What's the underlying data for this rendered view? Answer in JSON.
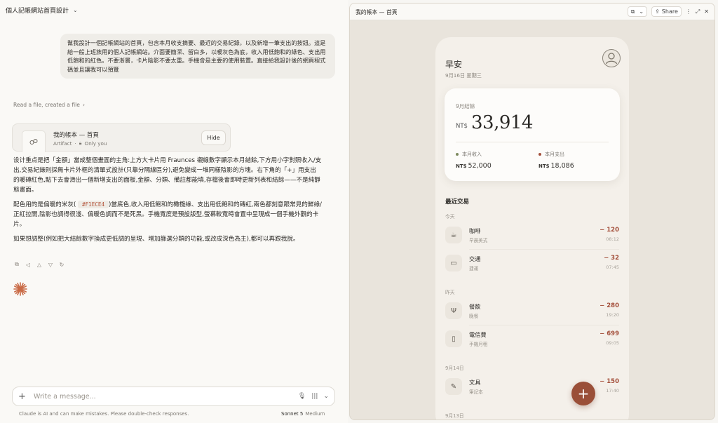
{
  "conversation": {
    "title": "個人記帳網站首頁設計",
    "user_message": "幫我設計一個記帳網站的首頁，包含本月收支摘要、最近的交易紀錄，以及新增一筆支出的按鈕。這是給一般上班族用的個人記帳網站。介面要簡潔、留白多，以暖灰色為底，收入用低飽和的綠色、支出用低飽和的紅色。不要漸層，卡片陰影不要太重。手機會是主要的使用裝置。直接給我設計後的網頁程式碼並且讓我可以預覽",
    "read_file": "Read a file, created a file",
    "artifact": {
      "title": "我的帳本 — 首頁",
      "type": "Artifact",
      "visibility": "Only you",
      "hide_label": "Hide"
    },
    "reply": {
      "p1": "设计重点是把「金額」當成整個畫面的主角:上方大卡片用 Fraunces 襯線數字顯示本月結餘,下方用小字對照收入/支出,交易紀錄則採無卡片外框的清單式設計(只靠分隔線區分),避免變成一堆同樣陰影的方塊。右下角的「+」用支出的暖磚紅色,點下去會滑出一個新增支出的面板,金額、分類、備註都能填,存檔後會即時更新列表和結餘——不是純靜態畫面。",
      "p2a": "配色用的是偏暖的米灰(",
      "p2code": "#F1ECE4",
      "p2b": ")當底色,收入用低飽和的橄欖綠、支出用低飽和的磚紅,兩色都刻意跟常見的鮮綠/正紅拉開,陰影也調得很淺、偏暖色調而不是死黑。手機寬度是預設版型,螢幕較寬時會置中呈現成一個手機外觀的卡片。",
      "p3": "如果想調整(例如把大結餘數字換成更低調的呈現、增加篩選分類的功能,或改成深色為主),都可以再跟我說。"
    },
    "composer": {
      "placeholder": "Write a message...",
      "disclaimer": "Claude is AI and can make mistakes. Please double-check responses.",
      "model": "Sonnet 5",
      "effort": "Medium"
    }
  },
  "preview": {
    "title": "我的帳本 — 首頁",
    "share_label": "Share",
    "app": {
      "greeting": "早安",
      "date": "9月16日 星期三",
      "balance_label": "9月結餘",
      "currency": "NT$",
      "balance": "33,914",
      "income_label": "本月收入",
      "income": "52,000",
      "expense_label": "本月支出",
      "expense": "18,086",
      "income_color": "#7d8a5e",
      "expense_color": "#a4503c",
      "recent_title": "最近交易",
      "groups": [
        "今天",
        "昨天",
        "9月14日",
        "9月13日"
      ],
      "transactions": [
        {
          "name": "咖啡",
          "note": "早晨美式",
          "amount": "− 120",
          "time": "08:12",
          "icon": "coffee-icon"
        },
        {
          "name": "交通",
          "note": "捷運",
          "amount": "− 32",
          "time": "07:45",
          "icon": "bus-icon"
        },
        {
          "name": "餐飲",
          "note": "晚餐",
          "amount": "− 280",
          "time": "19:20",
          "icon": "utensils-icon"
        },
        {
          "name": "電信費",
          "note": "手機月租",
          "amount": "− 699",
          "time": "09:05",
          "icon": "phone-icon"
        },
        {
          "name": "文具",
          "note": "筆記本",
          "amount": "− 150",
          "time": "17:40",
          "icon": "pencil-icon"
        }
      ]
    }
  }
}
